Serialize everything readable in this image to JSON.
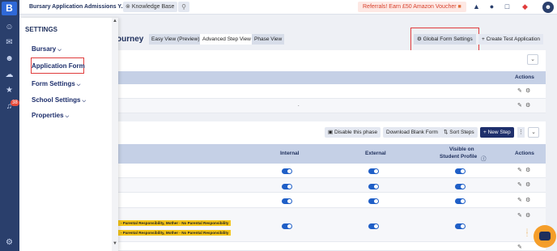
{
  "rail": {
    "logo": "B",
    "badge": "38"
  },
  "topbar": {
    "app_select": "Bursary Application Admissions Y...",
    "knowledge_base": "Knowledge Base",
    "referral": "Referrals! Earn £50 Amazon Voucher"
  },
  "page": {
    "title_fragment": "ourney",
    "views": [
      "Easy View (Preview)",
      "Advanced Step View",
      "Phase View"
    ],
    "global_form_settings": "Global Form Settings",
    "create_test": "Create Test Application"
  },
  "panel1": {
    "actions_header": "Actions",
    "dot": "."
  },
  "panel2": {
    "toolbar": {
      "disable_phase": "Disable this phase",
      "download_blank": "Download Blank Form",
      "sort_steps": "Sort Steps",
      "new_step": "New Step"
    },
    "columns": {
      "internal": "Internal",
      "external": "External",
      "visible_line1": "Visible on",
      "visible_line2": "Student Profile",
      "actions": "Actions"
    },
    "pills": [
      "- Parental Responsibility, Mother - No Parental Responsibility",
      "- Parental Responsibility, Mother - No Parental Responsibility"
    ]
  },
  "settings": {
    "title": "SETTINGS",
    "items": [
      "Bursary",
      "Application Form",
      "Form Settings",
      "School Settings",
      "Properties"
    ]
  },
  "colors": {
    "navy": "#1e2f5c",
    "accent": "#1f5fc7",
    "highlight": "#e03c3c",
    "pill": "#f5c518"
  }
}
